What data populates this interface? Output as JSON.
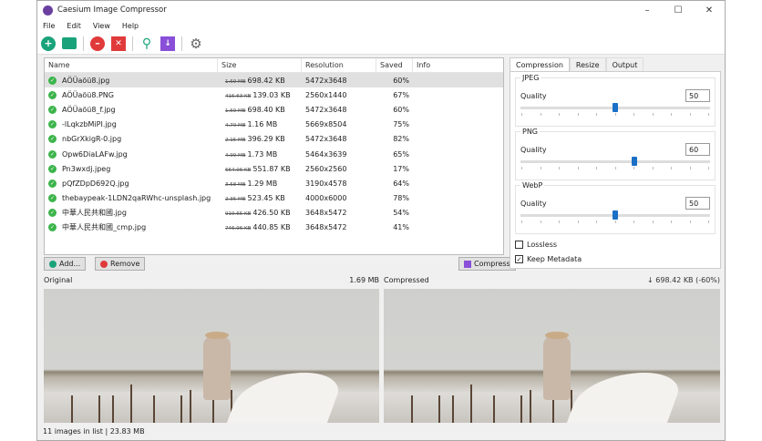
{
  "window": {
    "title": "Caesium Image Compressor",
    "controls": [
      "–",
      "☐",
      "✕"
    ]
  },
  "menu": [
    "File",
    "Edit",
    "View",
    "Help"
  ],
  "toolbar": [
    {
      "icon": "add-icon",
      "color": "#1aa37a"
    },
    {
      "icon": "folder-icon",
      "color": "#1aa37a"
    },
    {
      "icon": "remove-icon",
      "color": "#e03a3a"
    },
    {
      "icon": "clear-icon",
      "color": "#e03a3a"
    },
    {
      "icon": "search-icon",
      "color": "#1aa37a"
    },
    {
      "icon": "compress-icon",
      "color": "#8a4fd8"
    },
    {
      "icon": "settings-icon",
      "color": "#666666"
    }
  ],
  "list": {
    "columns": [
      "Name",
      "Size",
      "Resolution",
      "Saved",
      "Info"
    ],
    "rows": [
      {
        "name": "AÖÜaöü8.jpg",
        "old": "1.69 MB",
        "size": "698.42 KB",
        "res": "5472x3648",
        "saved": "60%",
        "info": ""
      },
      {
        "name": "AÖÜaöü8.PNG",
        "old": "415.63 KB",
        "size": "139.03 KB",
        "res": "2560x1440",
        "saved": "67%",
        "info": ""
      },
      {
        "name": "AÖÜaöü8_f.jpg",
        "old": "1.69 MB",
        "size": "698.40 KB",
        "res": "5472x3648",
        "saved": "60%",
        "info": ""
      },
      {
        "name": "-lLqkzbMiPI.jpg",
        "old": "4.70 MB",
        "size": "1.16 MB",
        "res": "5669x8504",
        "saved": "75%",
        "info": ""
      },
      {
        "name": "nbGrXkigR-0.jpg",
        "old": "2.15 MB",
        "size": "396.29 KB",
        "res": "5472x3648",
        "saved": "82%",
        "info": ""
      },
      {
        "name": "Opw6DiaLAFw.jpg",
        "old": "4.99 MB",
        "size": "1.73 MB",
        "res": "5464x3639",
        "saved": "65%",
        "info": ""
      },
      {
        "name": "Pn3wxdj.jpeg",
        "old": "664.06 KB",
        "size": "551.87 KB",
        "res": "2560x2560",
        "saved": "17%",
        "info": ""
      },
      {
        "name": "pQfZDpD692Q.jpg",
        "old": "3.58 MB",
        "size": "1.29 MB",
        "res": "3190x4578",
        "saved": "64%",
        "info": ""
      },
      {
        "name": "thebaypeak-1LDN2qaRWhc-unsplash.jpg",
        "old": "2.35 MB",
        "size": "523.45 KB",
        "res": "4000x6000",
        "saved": "78%",
        "info": ""
      },
      {
        "name": "中華人民共和國.jpg",
        "old": "919.65 KB",
        "size": "426.50 KB",
        "res": "3648x5472",
        "saved": "54%",
        "info": ""
      },
      {
        "name": "中華人民共和國_cmp.jpg",
        "old": "746.96 KB",
        "size": "440.85 KB",
        "res": "3648x5472",
        "saved": "41%",
        "info": ""
      }
    ]
  },
  "buttons": {
    "add": "Add...",
    "remove": "Remove",
    "compress": "Compress"
  },
  "panel": {
    "tabs": [
      "Compression",
      "Resize",
      "Output"
    ],
    "groups": [
      {
        "title": "JPEG",
        "label": "Quality",
        "value": "50",
        "level": 50
      },
      {
        "title": "PNG",
        "label": "Quality",
        "value": "60",
        "level": 60
      },
      {
        "title": "WebP",
        "label": "Quality",
        "value": "50",
        "level": 50
      }
    ],
    "lossless": {
      "label": "Lossless",
      "checked": false
    },
    "metadata": {
      "label": "Keep Metadata",
      "checked": true
    }
  },
  "preview": {
    "original_label": "Original",
    "original_size": "1.69 MB",
    "compressed_label": "Compressed",
    "compressed_size": "↓ 698.42 KB (-60%)"
  },
  "status": "11 images in list | 23.83 MB"
}
